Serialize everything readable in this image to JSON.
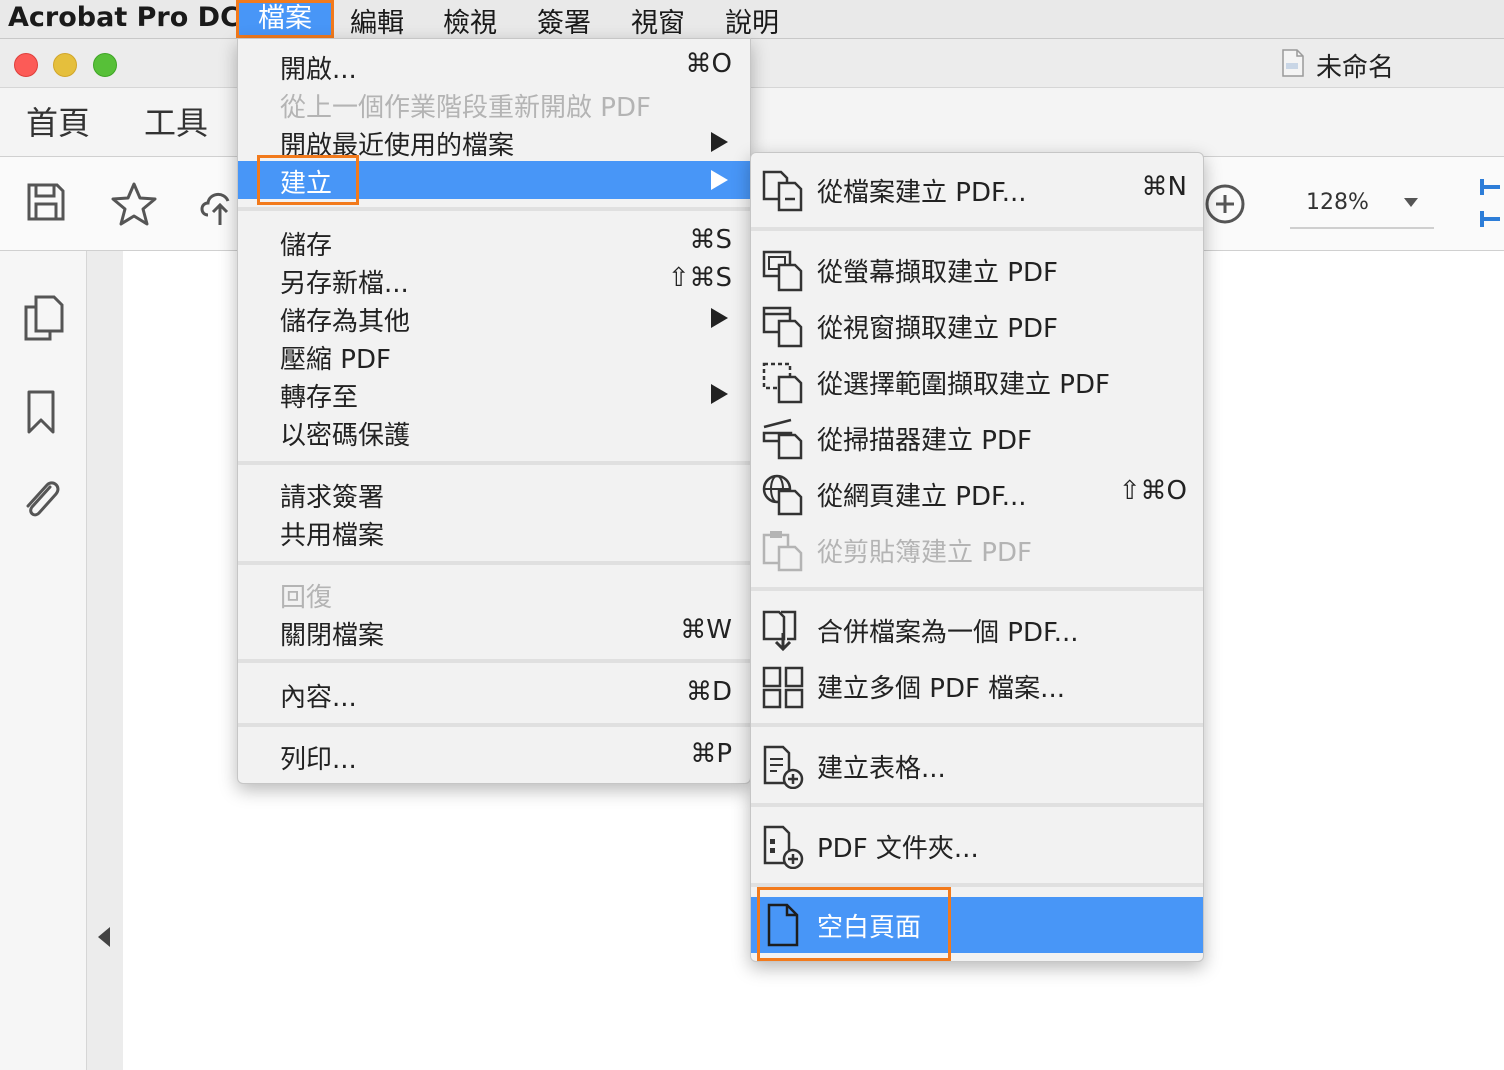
{
  "menubar": {
    "app_name": "Acrobat Pro DC",
    "items": [
      "檔案",
      "編輯",
      "檢視",
      "簽署",
      "視窗",
      "說明"
    ]
  },
  "window": {
    "title": "未命名"
  },
  "tabs": [
    "首頁",
    "工具"
  ],
  "toolbar": {
    "zoom": "128%"
  },
  "file_menu": {
    "open": {
      "label": "開啟...",
      "shortcut": "⌘O"
    },
    "reopen": {
      "label": "從上一個作業階段重新開啟 PDF"
    },
    "open_recent": {
      "label": "開啟最近使用的檔案"
    },
    "create": {
      "label": "建立"
    },
    "save": {
      "label": "儲存",
      "shortcut": "⌘S"
    },
    "save_as": {
      "label": "另存新檔...",
      "shortcut": "⇧⌘S"
    },
    "save_as_other": {
      "label": "儲存為其他"
    },
    "compress": {
      "label": "壓縮 PDF"
    },
    "export_to": {
      "label": "轉存至"
    },
    "protect": {
      "label": "以密碼保護"
    },
    "request_sign": {
      "label": "請求簽署"
    },
    "share": {
      "label": "共用檔案"
    },
    "revert": {
      "label": "回復"
    },
    "close": {
      "label": "關閉檔案",
      "shortcut": "⌘W"
    },
    "properties": {
      "label": "內容...",
      "shortcut": "⌘D"
    },
    "print": {
      "label": "列印...",
      "shortcut": "⌘P"
    }
  },
  "create_menu": {
    "from_file": {
      "label": "從檔案建立 PDF...",
      "shortcut": "⌘N"
    },
    "from_screen": {
      "label": "從螢幕擷取建立 PDF"
    },
    "from_window": {
      "label": "從視窗擷取建立 PDF"
    },
    "from_selection": {
      "label": "從選擇範圍擷取建立 PDF"
    },
    "from_scanner": {
      "label": "從掃描器建立 PDF"
    },
    "from_web": {
      "label": "從網頁建立 PDF...",
      "shortcut": "⇧⌘O"
    },
    "from_clipboard": {
      "label": "從剪貼簿建立 PDF"
    },
    "combine": {
      "label": "合併檔案為一個 PDF..."
    },
    "multiple": {
      "label": "建立多個 PDF 檔案..."
    },
    "form": {
      "label": "建立表格..."
    },
    "portfolio": {
      "label": "PDF 文件夾..."
    },
    "blank_page": {
      "label": "空白頁面"
    }
  },
  "colors": {
    "highlight": "#4896f7",
    "annotation": "#f27a1c",
    "traffic_red": "#fc5b57",
    "traffic_yellow": "#e5bf3c",
    "traffic_green": "#57c038"
  }
}
